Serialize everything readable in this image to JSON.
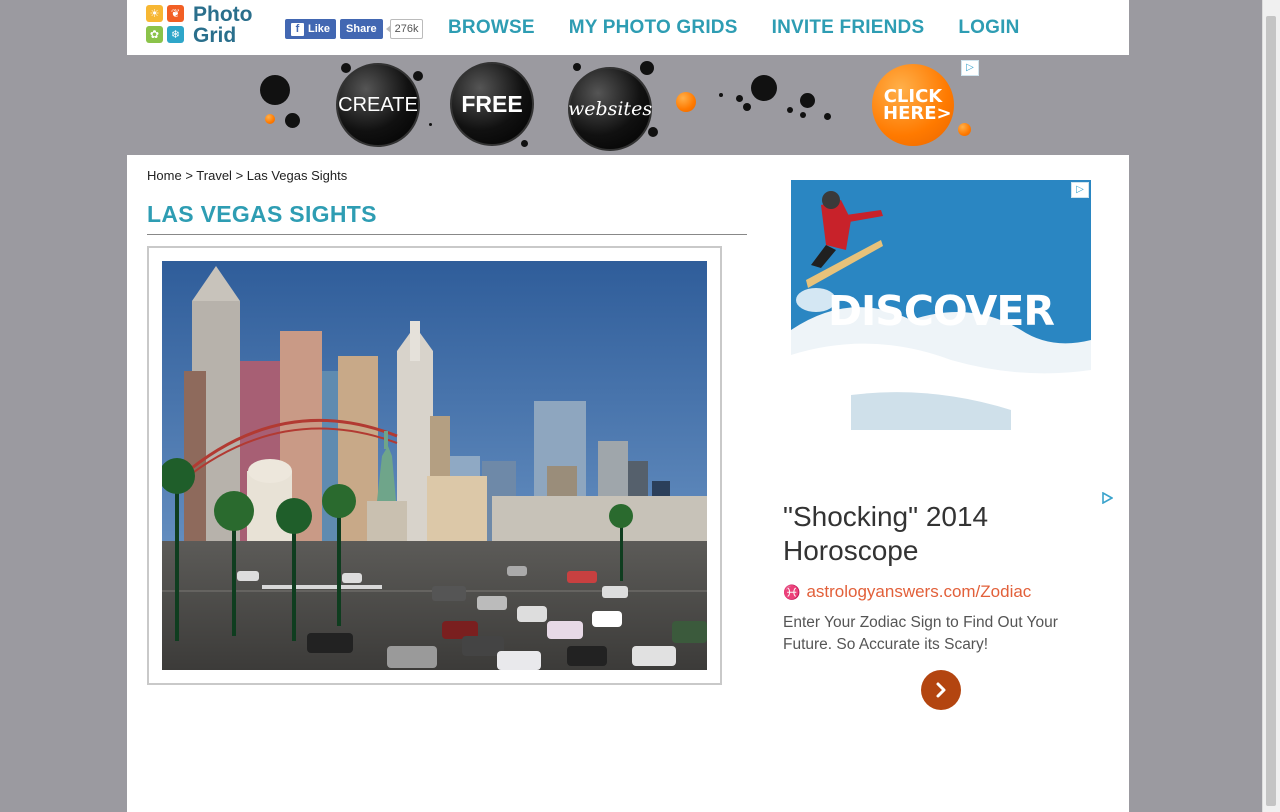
{
  "site": {
    "logo_line1": "Photo",
    "logo_line2": "Grid"
  },
  "facebook": {
    "like_label": "Like",
    "share_label": "Share",
    "count": "276k"
  },
  "nav": {
    "items": [
      "BROWSE",
      "MY PHOTO GRIDS",
      "INVITE FRIENDS",
      "LOGIN"
    ]
  },
  "banner": {
    "words": [
      "CREATE",
      "FREE",
      "websites"
    ],
    "cta": "CLICK HERE>",
    "accent": "#ff7a00"
  },
  "breadcrumb": {
    "home": "Home",
    "sep": ">",
    "category": "Travel",
    "current": "Las Vegas Sights"
  },
  "page": {
    "title": "LAS VEGAS SIGHTS",
    "accent": "#2e9db3"
  },
  "ad_top": {
    "headline": "DISCOVER"
  },
  "ad_text": {
    "headline": "\"Shocking\" 2014 Horoscope",
    "url": "astrologyanswers.com/Zodiac",
    "description": "Enter Your Zodiac Sign to Find Out Your Future. So Accurate its Scary!",
    "button_color": "#b34510"
  }
}
